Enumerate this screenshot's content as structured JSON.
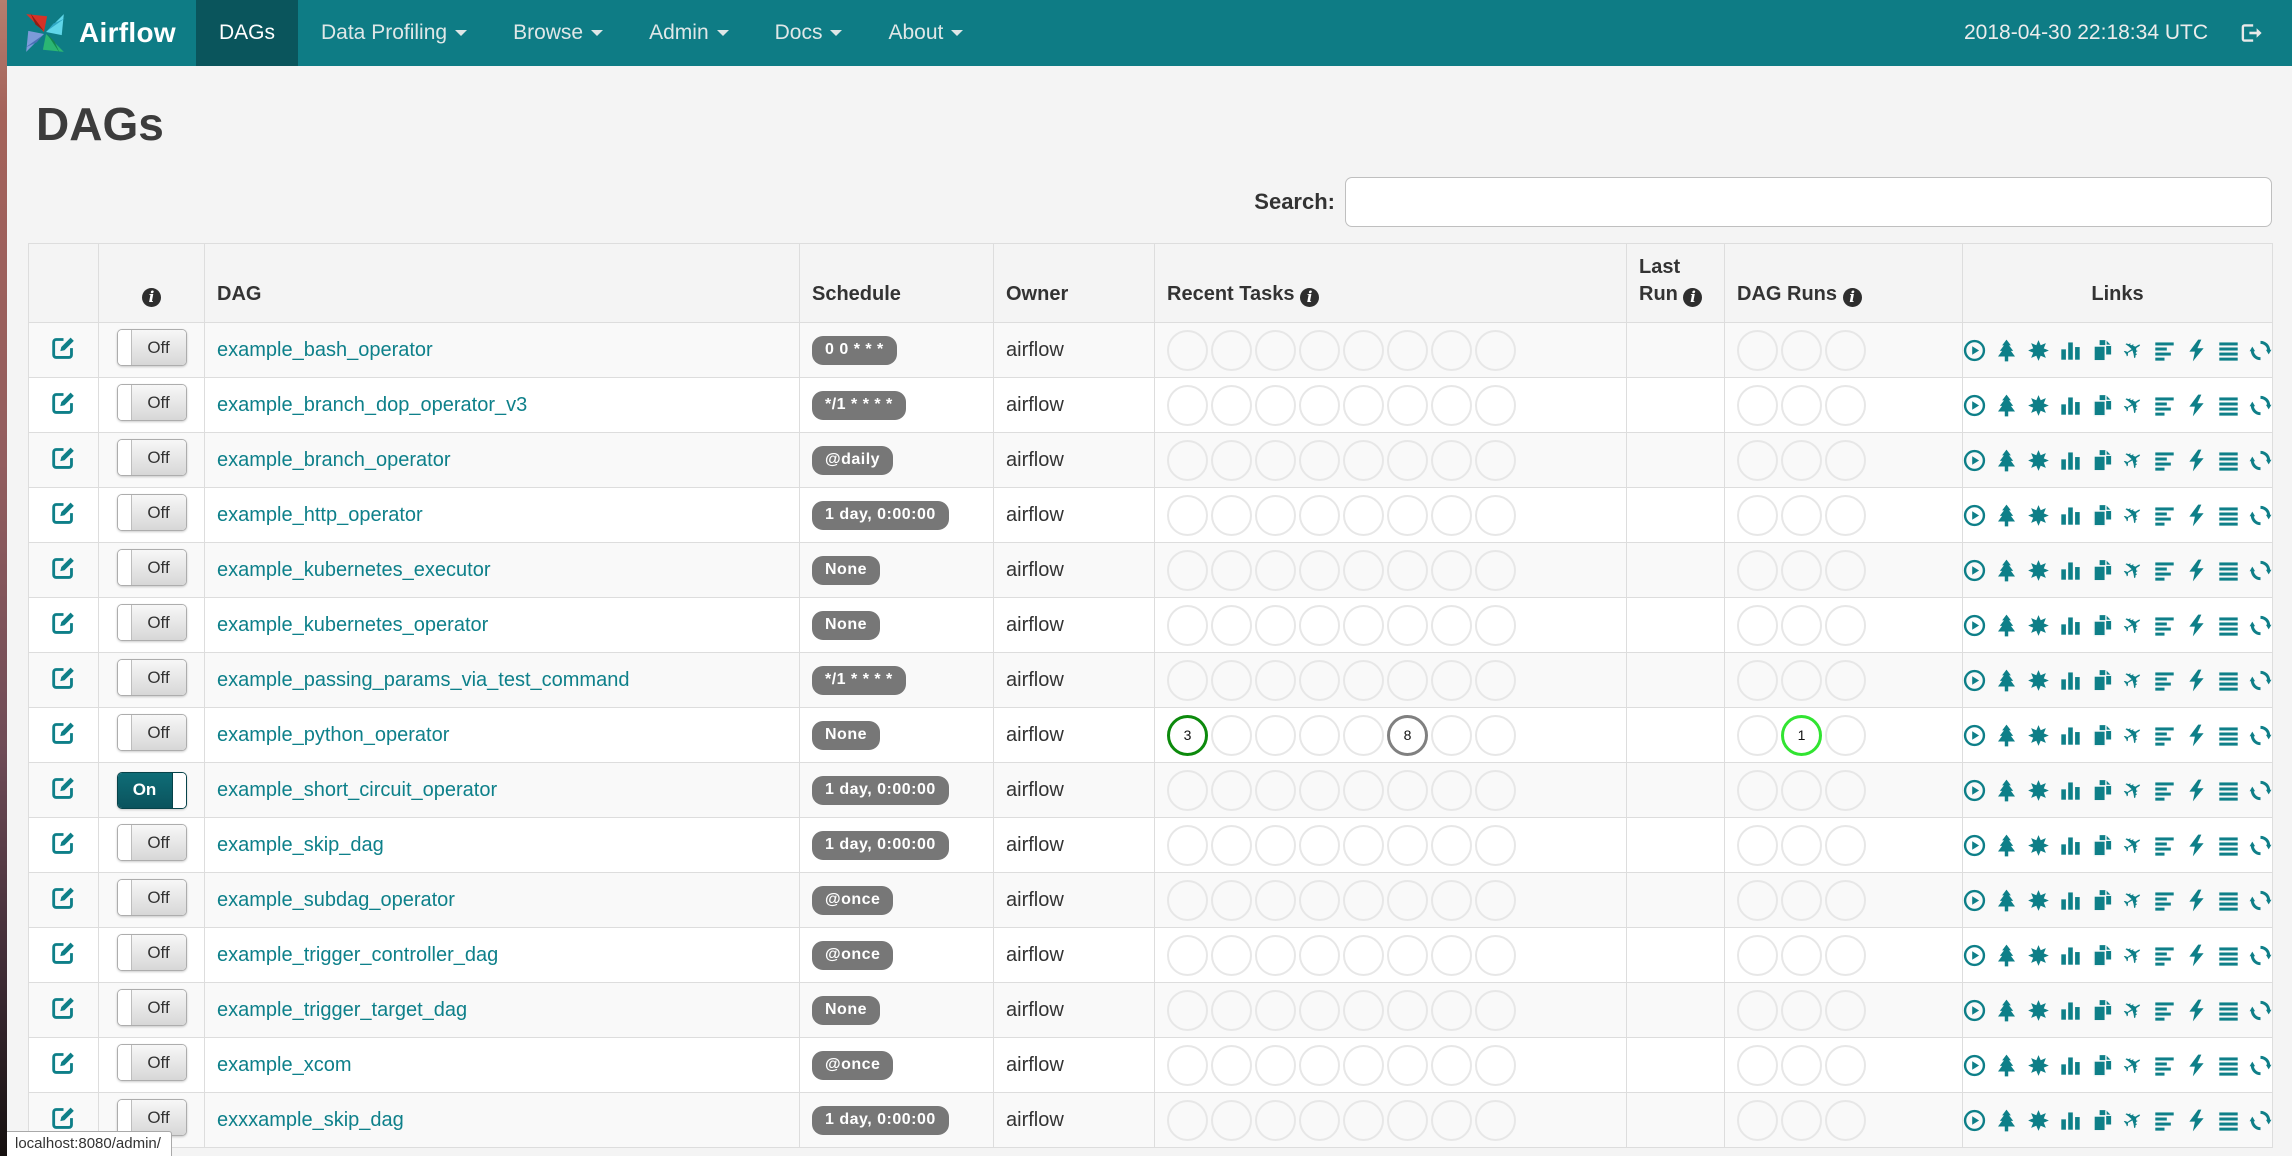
{
  "navbar": {
    "brand": "Airflow",
    "items": [
      {
        "label": "DAGs",
        "active": true,
        "dropdown": false
      },
      {
        "label": "Data Profiling",
        "active": false,
        "dropdown": true
      },
      {
        "label": "Browse",
        "active": false,
        "dropdown": true
      },
      {
        "label": "Admin",
        "active": false,
        "dropdown": true
      },
      {
        "label": "Docs",
        "active": false,
        "dropdown": true
      },
      {
        "label": "About",
        "active": false,
        "dropdown": true
      }
    ],
    "clock": "2018-04-30 22:18:34 UTC"
  },
  "page": {
    "title": "DAGs",
    "search_label": "Search:",
    "search_value": ""
  },
  "statusbar": {
    "url": "localhost:8080/admin/"
  },
  "colors": {
    "navbar": "#0E7C85",
    "navbar_active": "#0A555C",
    "link": "#0E808A",
    "badge_bg": "#777777",
    "state_success": "#0c8a0c",
    "state_queued": "#808080",
    "state_running": "#31e431"
  },
  "table": {
    "headers": {
      "dag": "DAG",
      "schedule": "Schedule",
      "owner": "Owner",
      "recent_tasks": "Recent Tasks",
      "last_run_line1": "Last",
      "last_run_line2": "Run",
      "dag_runs": "DAG Runs",
      "links": "Links"
    },
    "recent_tasks_slots": 8,
    "dag_runs_slots": 3,
    "links_icons": [
      {
        "name": "trigger-dag-icon",
        "glyph": "play-circle"
      },
      {
        "name": "tree-view-icon",
        "glyph": "tree"
      },
      {
        "name": "graph-view-icon",
        "glyph": "burst"
      },
      {
        "name": "task-duration-icon",
        "glyph": "bar-chart"
      },
      {
        "name": "task-tries-icon",
        "glyph": "pages"
      },
      {
        "name": "landing-times-icon",
        "glyph": "plane"
      },
      {
        "name": "gantt-view-icon",
        "glyph": "align-left"
      },
      {
        "name": "code-view-icon",
        "glyph": "bolt"
      },
      {
        "name": "dag-details-icon",
        "glyph": "align-justify"
      },
      {
        "name": "refresh-icon",
        "glyph": "refresh"
      }
    ],
    "rows": [
      {
        "dag": "example_bash_operator",
        "toggle": "Off",
        "schedule": "0 0 * * *",
        "owner": "airflow",
        "recent_tasks": [],
        "dag_runs": []
      },
      {
        "dag": "example_branch_dop_operator_v3",
        "toggle": "Off",
        "schedule": "*/1 * * * *",
        "owner": "airflow",
        "recent_tasks": [],
        "dag_runs": []
      },
      {
        "dag": "example_branch_operator",
        "toggle": "Off",
        "schedule": "@daily",
        "owner": "airflow",
        "recent_tasks": [],
        "dag_runs": []
      },
      {
        "dag": "example_http_operator",
        "toggle": "Off",
        "schedule": "1 day, 0:00:00",
        "owner": "airflow",
        "recent_tasks": [],
        "dag_runs": []
      },
      {
        "dag": "example_kubernetes_executor",
        "toggle": "Off",
        "schedule": "None",
        "owner": "airflow",
        "recent_tasks": [],
        "dag_runs": []
      },
      {
        "dag": "example_kubernetes_operator",
        "toggle": "Off",
        "schedule": "None",
        "owner": "airflow",
        "recent_tasks": [],
        "dag_runs": []
      },
      {
        "dag": "example_passing_params_via_test_command",
        "toggle": "Off",
        "schedule": "*/1 * * * *",
        "owner": "airflow",
        "recent_tasks": [],
        "dag_runs": []
      },
      {
        "dag": "example_python_operator",
        "toggle": "Off",
        "schedule": "None",
        "owner": "airflow",
        "recent_tasks": [
          {
            "slot": 0,
            "count": 3,
            "state": "success",
            "color": "#0c8a0c"
          },
          {
            "slot": 5,
            "count": 8,
            "state": "queued",
            "color": "#808080"
          }
        ],
        "dag_runs": [
          {
            "slot": 1,
            "count": 1,
            "state": "running",
            "color": "#31e431"
          }
        ]
      },
      {
        "dag": "example_short_circuit_operator",
        "toggle": "On",
        "schedule": "1 day, 0:00:00",
        "owner": "airflow",
        "recent_tasks": [],
        "dag_runs": []
      },
      {
        "dag": "example_skip_dag",
        "toggle": "Off",
        "schedule": "1 day, 0:00:00",
        "owner": "airflow",
        "recent_tasks": [],
        "dag_runs": []
      },
      {
        "dag": "example_subdag_operator",
        "toggle": "Off",
        "schedule": "@once",
        "owner": "airflow",
        "recent_tasks": [],
        "dag_runs": []
      },
      {
        "dag": "example_trigger_controller_dag",
        "toggle": "Off",
        "schedule": "@once",
        "owner": "airflow",
        "recent_tasks": [],
        "dag_runs": []
      },
      {
        "dag": "example_trigger_target_dag",
        "toggle": "Off",
        "schedule": "None",
        "owner": "airflow",
        "recent_tasks": [],
        "dag_runs": []
      },
      {
        "dag": "example_xcom",
        "toggle": "Off",
        "schedule": "@once",
        "owner": "airflow",
        "recent_tasks": [],
        "dag_runs": []
      },
      {
        "dag": "exxxample_skip_dag",
        "toggle": "Off",
        "schedule": "1 day, 0:00:00",
        "owner": "airflow",
        "recent_tasks": [],
        "dag_runs": []
      }
    ]
  }
}
